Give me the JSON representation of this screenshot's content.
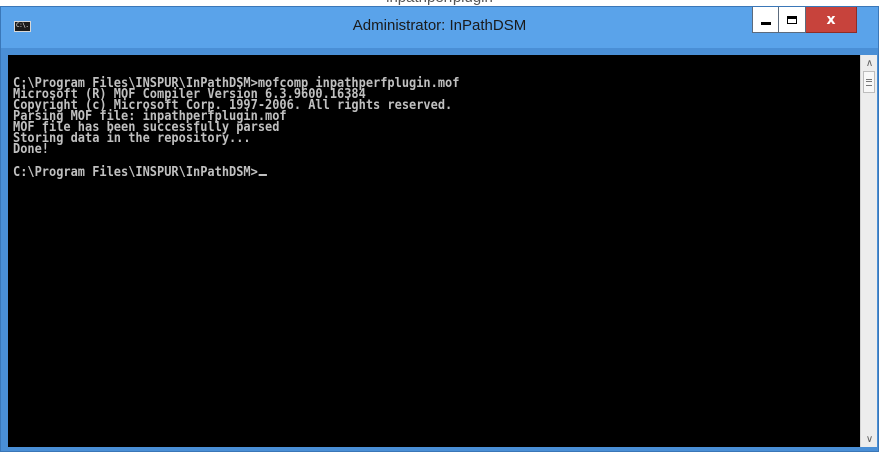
{
  "window": {
    "title": "Administrator: InPathDSM",
    "icon": "cmd-console-icon",
    "icon_text": "C:\\."
  },
  "controls": {
    "minimize_icon": "minimize-icon",
    "maximize_icon": "maximize-icon",
    "close_icon": "close-icon",
    "close_label": "x"
  },
  "console": {
    "lines": [
      "C:\\Program Files\\INSPUR\\InPathDSM>mofcomp inpathperfplugin.mof",
      "Microsoft (R) MOF Compiler Version 6.3.9600.16384",
      "Copyright (c) Microsoft Corp. 1997-2006. All rights reserved.",
      "Parsing MOF file: inpathperfplugin.mof",
      "MOF file has been successfully parsed",
      "Storing data in the repository...",
      "Done!",
      "",
      "C:\\Program Files\\INSPUR\\InPathDSM>"
    ]
  },
  "scrollbar": {
    "up_icon": "scroll-up-arrow-icon",
    "down_icon": "scroll-down-arrow-icon"
  },
  "colors": {
    "titlebar": "#5aa3ea",
    "close_button": "#c7433c",
    "console_bg": "#000000",
    "console_text": "#c0c0c0"
  }
}
